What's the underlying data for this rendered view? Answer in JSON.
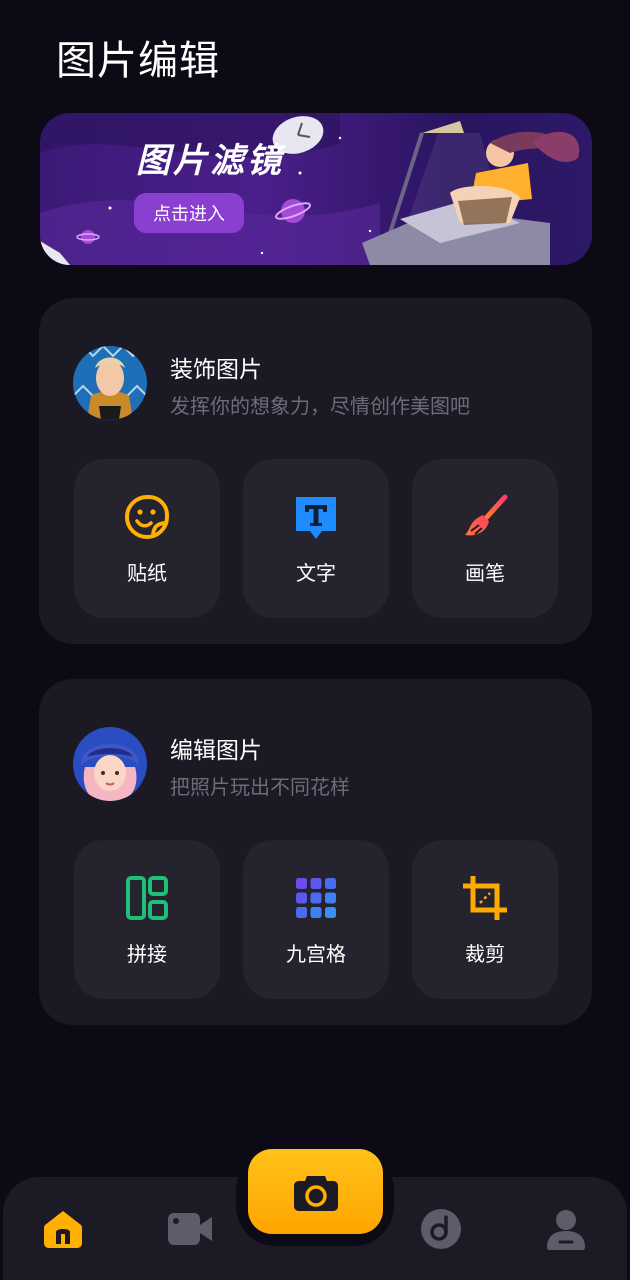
{
  "page": {
    "title": "图片编辑"
  },
  "banner": {
    "title": "图片滤镜",
    "button_label": "点击进入"
  },
  "sections": [
    {
      "title": "装饰图片",
      "subtitle": "发挥你的想象力，尽情创作美图吧",
      "tools": [
        {
          "label": "贴纸",
          "icon": "sticker-icon"
        },
        {
          "label": "文字",
          "icon": "text-icon"
        },
        {
          "label": "画笔",
          "icon": "brush-icon"
        }
      ]
    },
    {
      "title": "编辑图片",
      "subtitle": "把照片玩出不同花样",
      "tools": [
        {
          "label": "拼接",
          "icon": "collage-icon"
        },
        {
          "label": "九宫格",
          "icon": "grid-icon"
        },
        {
          "label": "裁剪",
          "icon": "crop-icon"
        }
      ]
    }
  ],
  "bottom_nav": {
    "items": [
      {
        "icon": "home-icon",
        "active": true
      },
      {
        "icon": "video-icon",
        "active": false
      },
      {
        "icon": "camera-icon",
        "active": false
      },
      {
        "icon": "music-disc-icon",
        "active": false
      },
      {
        "icon": "profile-icon",
        "active": false
      }
    ]
  },
  "colors": {
    "background": "#0c0a14",
    "card": "#1b1924",
    "tile": "#25232e",
    "accent_yellow": "#ffb000",
    "subtitle_gray": "#6e6b79",
    "banner_button": "#8a3fd0"
  }
}
